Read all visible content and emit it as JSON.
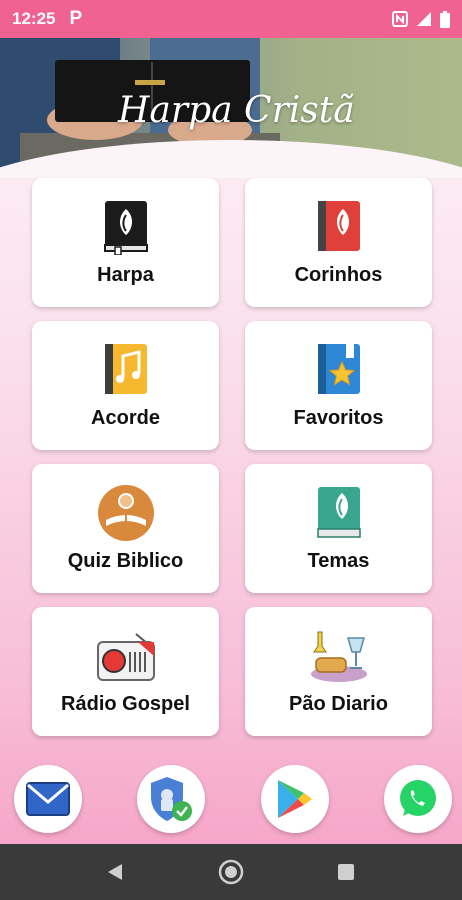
{
  "status_bar": {
    "time": "12:25",
    "notification_icon": "P",
    "icons": [
      "nfc-icon",
      "signal-icon",
      "battery-icon"
    ]
  },
  "header": {
    "title": "Harpa Cristã"
  },
  "menu": {
    "items": [
      {
        "label": "Harpa",
        "icon": "black-book-icon"
      },
      {
        "label": "Corinhos",
        "icon": "red-book-icon"
      },
      {
        "label": "Acorde",
        "icon": "music-book-icon"
      },
      {
        "label": "Favoritos",
        "icon": "star-book-icon"
      },
      {
        "label": "Quiz Biblico",
        "icon": "bible-quiz-icon"
      },
      {
        "label": "Temas",
        "icon": "green-book-icon"
      },
      {
        "label": "Rádio Gospel",
        "icon": "radio-icon"
      },
      {
        "label": "Pão Diario",
        "icon": "bread-wine-icon"
      }
    ]
  },
  "dock": {
    "items": [
      "mail-icon",
      "security-shield-icon",
      "play-store-icon",
      "whatsapp-icon"
    ]
  },
  "colors": {
    "status_bar": "#f06292",
    "nav_bar": "#3a3a3a",
    "card": "#ffffff"
  }
}
